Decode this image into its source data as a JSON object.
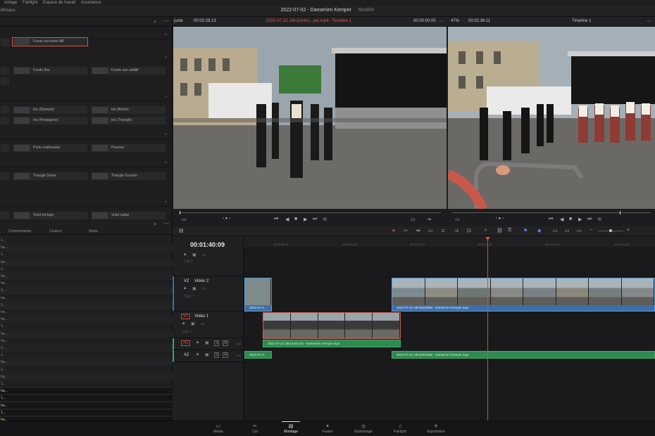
{
  "menu": [
    "ontage",
    "Fairlight",
    "Espace de travail",
    "Assistance"
  ],
  "title": {
    "project": "2022-07-02 - Danserien Kemper",
    "status": "Modifié",
    "library_label": "othèque"
  },
  "effects": {
    "selected": "Fondu enchaîné dB",
    "rows": [
      {
        "left": "Fondu flou",
        "right": "Fondu non additif"
      },
      {
        "left": "Iris (Diamant)",
        "right": "Iris (flèche)"
      },
      {
        "left": "Iris (Pentagone)",
        "right": "Iris (Triangle)"
      },
      {
        "left": "Porte coulissante",
        "right": "Pousser"
      },
      {
        "left": "Triangle Droite",
        "right": "Triangle Gauche"
      },
      {
        "left": "Volet horloge",
        "right": "Volet radial"
      }
    ]
  },
  "list": {
    "headers": [
      "Commentaires",
      "Couleur",
      "Notes"
    ],
    "rows": [
      "1...",
      "ha...",
      "1...",
      "ha...",
      "1...",
      "ha...",
      "ha...",
      "1...",
      "ha...",
      "1...",
      "ha...",
      "ha...",
      "1...",
      "ha...",
      "ha...",
      "1...",
      "1...",
      "ha...",
      "1...",
      "ha...",
      "1...",
      "ha...",
      "1...",
      "ha...",
      "1...",
      "ha...",
      "1..."
    ]
  },
  "source_viewer": {
    "fit": "juste",
    "timecode": "00:00:28:13",
    "clip": "2022-07-22 18h11min1...per.mp4 - Timeline 1",
    "duration": "00:00:00:00"
  },
  "timeline_viewer": {
    "zoom": "47%",
    "timecode": "00:02:36:11",
    "timeline": "Timeline 1"
  },
  "timeline": {
    "timecode": "00:01:40:09",
    "tracks": {
      "v3": {
        "name": "Clip 0"
      },
      "v2": {
        "id": "V2",
        "name": "Vidéo 2",
        "clips": "Clip 3"
      },
      "v1": {
        "id": "V1",
        "name": "Vidéo 1",
        "clips": "Clip 2"
      },
      "a1": {
        "id": "A1",
        "level": "2.0"
      },
      "a2": {
        "id": "A2",
        "level": "2.0"
      }
    },
    "clip_labels": {
      "v2_short": "2022-07-2...",
      "v2_long": "2022-07-22 18h15min59s - Danserien Kemper.mp4",
      "v1": "2022-07-...",
      "a1": "2022-07-22 18h11min13s - Danserien Kemper.mp4",
      "a2_short": "2022-07-2...",
      "a2_long": "2022-07-22 18h15min59s - Danserien Kemper.mp4"
    },
    "ruler_ticks": [
      "00:01:36:24",
      "00:01:38:00",
      "00:01:39:24",
      "00:01:41:00",
      "00:01:42:24",
      "00:01:44:00"
    ]
  },
  "pages": [
    {
      "label": "Média",
      "icon": "▭"
    },
    {
      "label": "Cut",
      "icon": "✂"
    },
    {
      "label": "Montage",
      "icon": "▤"
    },
    {
      "label": "Fusion",
      "icon": "✦"
    },
    {
      "label": "Étalonnage",
      "icon": "◎"
    },
    {
      "label": "Fairlight",
      "icon": "♫"
    },
    {
      "label": "Exportation",
      "icon": "✈"
    }
  ],
  "active_page": "Montage",
  "colors": {
    "accent_red": "#e2523c",
    "clip_blue": "#3d6ea8",
    "audio_green": "#2f8a52",
    "playhead": "#e0473a"
  }
}
